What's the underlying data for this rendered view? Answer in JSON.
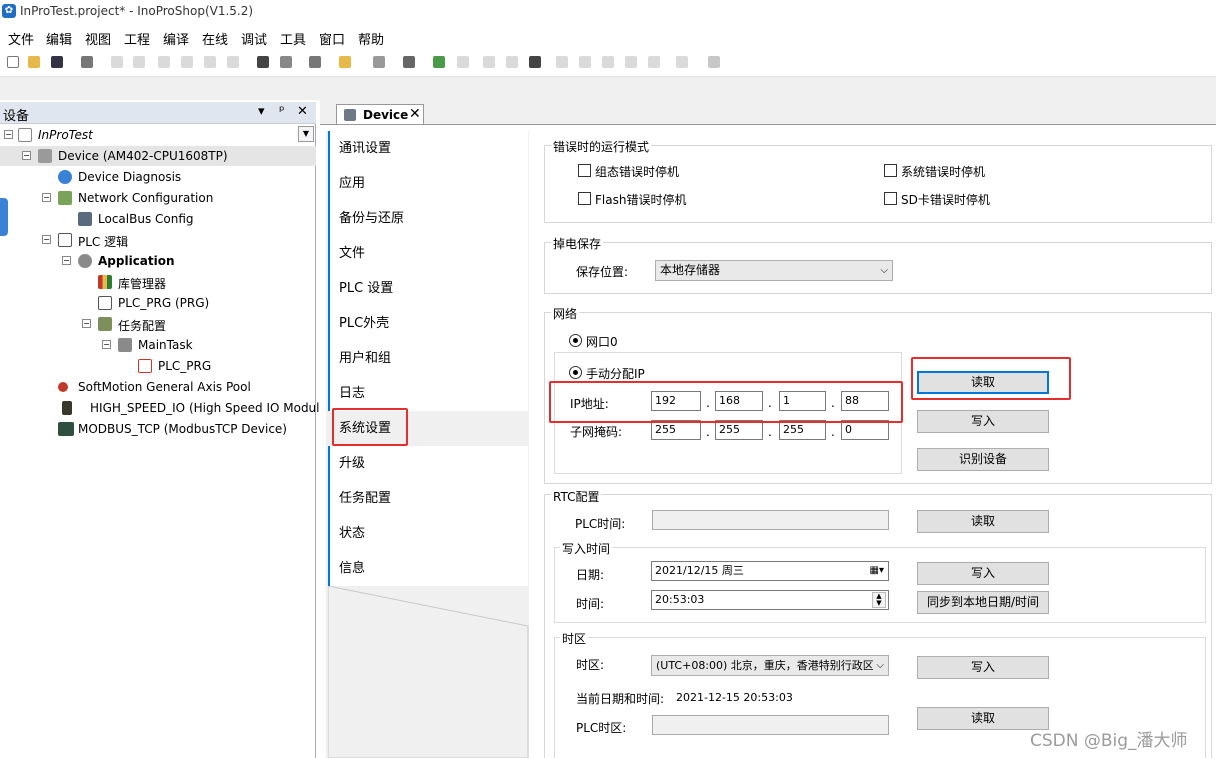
{
  "window": {
    "title": "InProTest.project* - InoProShop(V1.5.2)"
  },
  "menu": [
    "文件",
    "编辑",
    "视图",
    "工程",
    "编译",
    "在线",
    "调试",
    "工具",
    "窗口",
    "帮助"
  ],
  "devices_panel": {
    "title": "设备",
    "controls": [
      "▾",
      "ᵖ",
      "✕"
    ],
    "tree": [
      {
        "label": "InProTest",
        "italic": true
      },
      {
        "label": "Device (AM402-CPU1608TP)"
      },
      {
        "label": "Device Diagnosis"
      },
      {
        "label": "Network Configuration"
      },
      {
        "label": "LocalBus Config"
      },
      {
        "label": "PLC 逻辑"
      },
      {
        "label": "Application",
        "bold": true
      },
      {
        "label": "库管理器"
      },
      {
        "label": "PLC_PRG (PRG)"
      },
      {
        "label": "任务配置"
      },
      {
        "label": "MainTask"
      },
      {
        "label": "PLC_PRG"
      },
      {
        "label": "SoftMotion General Axis Pool"
      },
      {
        "label": "HIGH_SPEED_IO (High Speed IO Module)"
      },
      {
        "label": "MODBUS_TCP (ModbusTCP Device)"
      }
    ]
  },
  "doc_tab": {
    "label": "Device",
    "close": "✕"
  },
  "nav": [
    "通讯设置",
    "应用",
    "备份与还原",
    "文件",
    "PLC 设置",
    "PLC外壳",
    "用户和组",
    "日志",
    "系统设置",
    "升级",
    "任务配置",
    "状态",
    "信息"
  ],
  "error_mode": {
    "title": "错误时的运行模式",
    "options": [
      "组态错误时停机",
      "系统错误时停机",
      "Flash错误时停机",
      "SD卡错误时停机"
    ]
  },
  "power_save": {
    "title": "掉电保存",
    "label": "保存位置:",
    "value": "本地存储器"
  },
  "network": {
    "title": "网络",
    "port": "网口0",
    "mode": "手动分配IP",
    "ip_label": "IP地址:",
    "ip": [
      "192",
      "168",
      "1",
      "88"
    ],
    "mask_label": "子网掩码:",
    "mask": [
      "255",
      "255",
      "255",
      "0"
    ],
    "sep": ".",
    "buttons": {
      "read": "读取",
      "write": "写入",
      "identify": "识别设备"
    }
  },
  "rtc": {
    "title": "RTC配置",
    "plc_time_label": "PLC时间:",
    "read": "读取",
    "write_time": {
      "title": "写入时间",
      "date_label": "日期:",
      "date_value": "2021/12/15 周三",
      "time_label": "时间:",
      "time_value": "20:53:03",
      "write": "写入",
      "sync": "同步到本地日期/时间"
    },
    "timezone": {
      "title": "时区",
      "tz_label": "时区:",
      "tz_value": "(UTC+08:00) 北京，重庆，香港特别行政区",
      "write": "写入",
      "current_label": "当前日期和时间:",
      "current_value": "2021-12-15 20:53:03",
      "plc_tz_label": "PLC时区:",
      "read": "读取"
    }
  },
  "watermark": "CSDN @Big_潘大师"
}
